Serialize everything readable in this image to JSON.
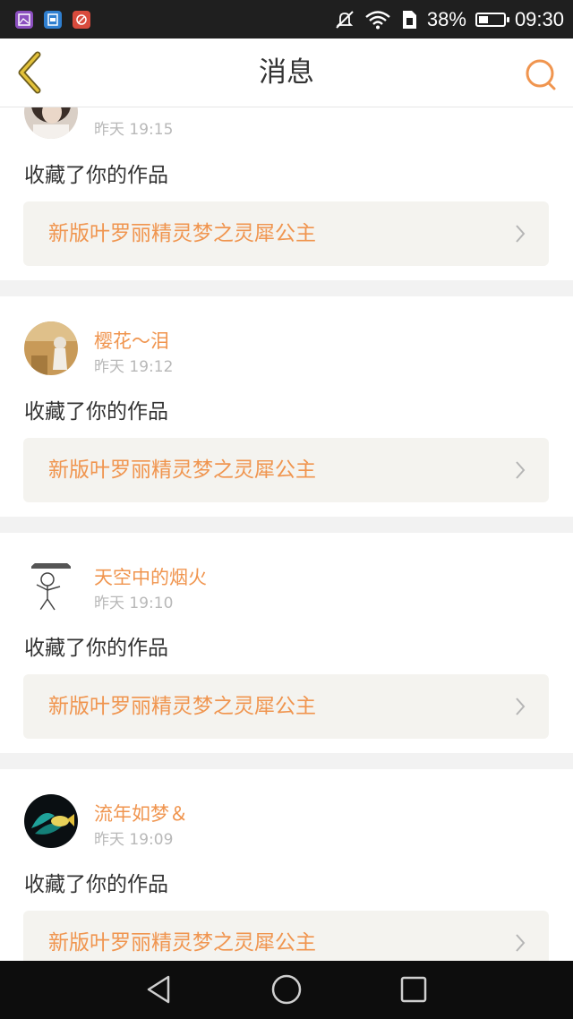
{
  "status_bar": {
    "battery_percent": "38%",
    "time": "09:30",
    "icons": [
      "gallery-app-icon",
      "sim-app-icon",
      "tools-app-icon",
      "mute-icon",
      "wifi-icon",
      "data-sim-icon",
      "battery-icon"
    ],
    "battery_level": 0.38
  },
  "header": {
    "title": "消息",
    "back_icon": "chevron-left-icon",
    "search_icon": "search-icon",
    "accent_color": "#f0954f"
  },
  "messages": [
    {
      "username": "",
      "time": "昨天 19:15",
      "action": "收藏了你的作品",
      "work_title": "新版叶罗丽精灵梦之灵犀公主"
    },
    {
      "username": "樱花～泪",
      "time": "昨天 19:12",
      "action": "收藏了你的作品",
      "work_title": "新版叶罗丽精灵梦之灵犀公主"
    },
    {
      "username": "天空中的烟火",
      "time": "昨天 19:10",
      "action": "收藏了你的作品",
      "work_title": "新版叶罗丽精灵梦之灵犀公主"
    },
    {
      "username": "流年如梦＆",
      "time": "昨天 19:09",
      "action": "收藏了你的作品",
      "work_title": "新版叶罗丽精灵梦之灵犀公主"
    }
  ],
  "nav_bar": {
    "icons": [
      "back-triangle-icon",
      "home-circle-icon",
      "recents-square-icon"
    ]
  }
}
